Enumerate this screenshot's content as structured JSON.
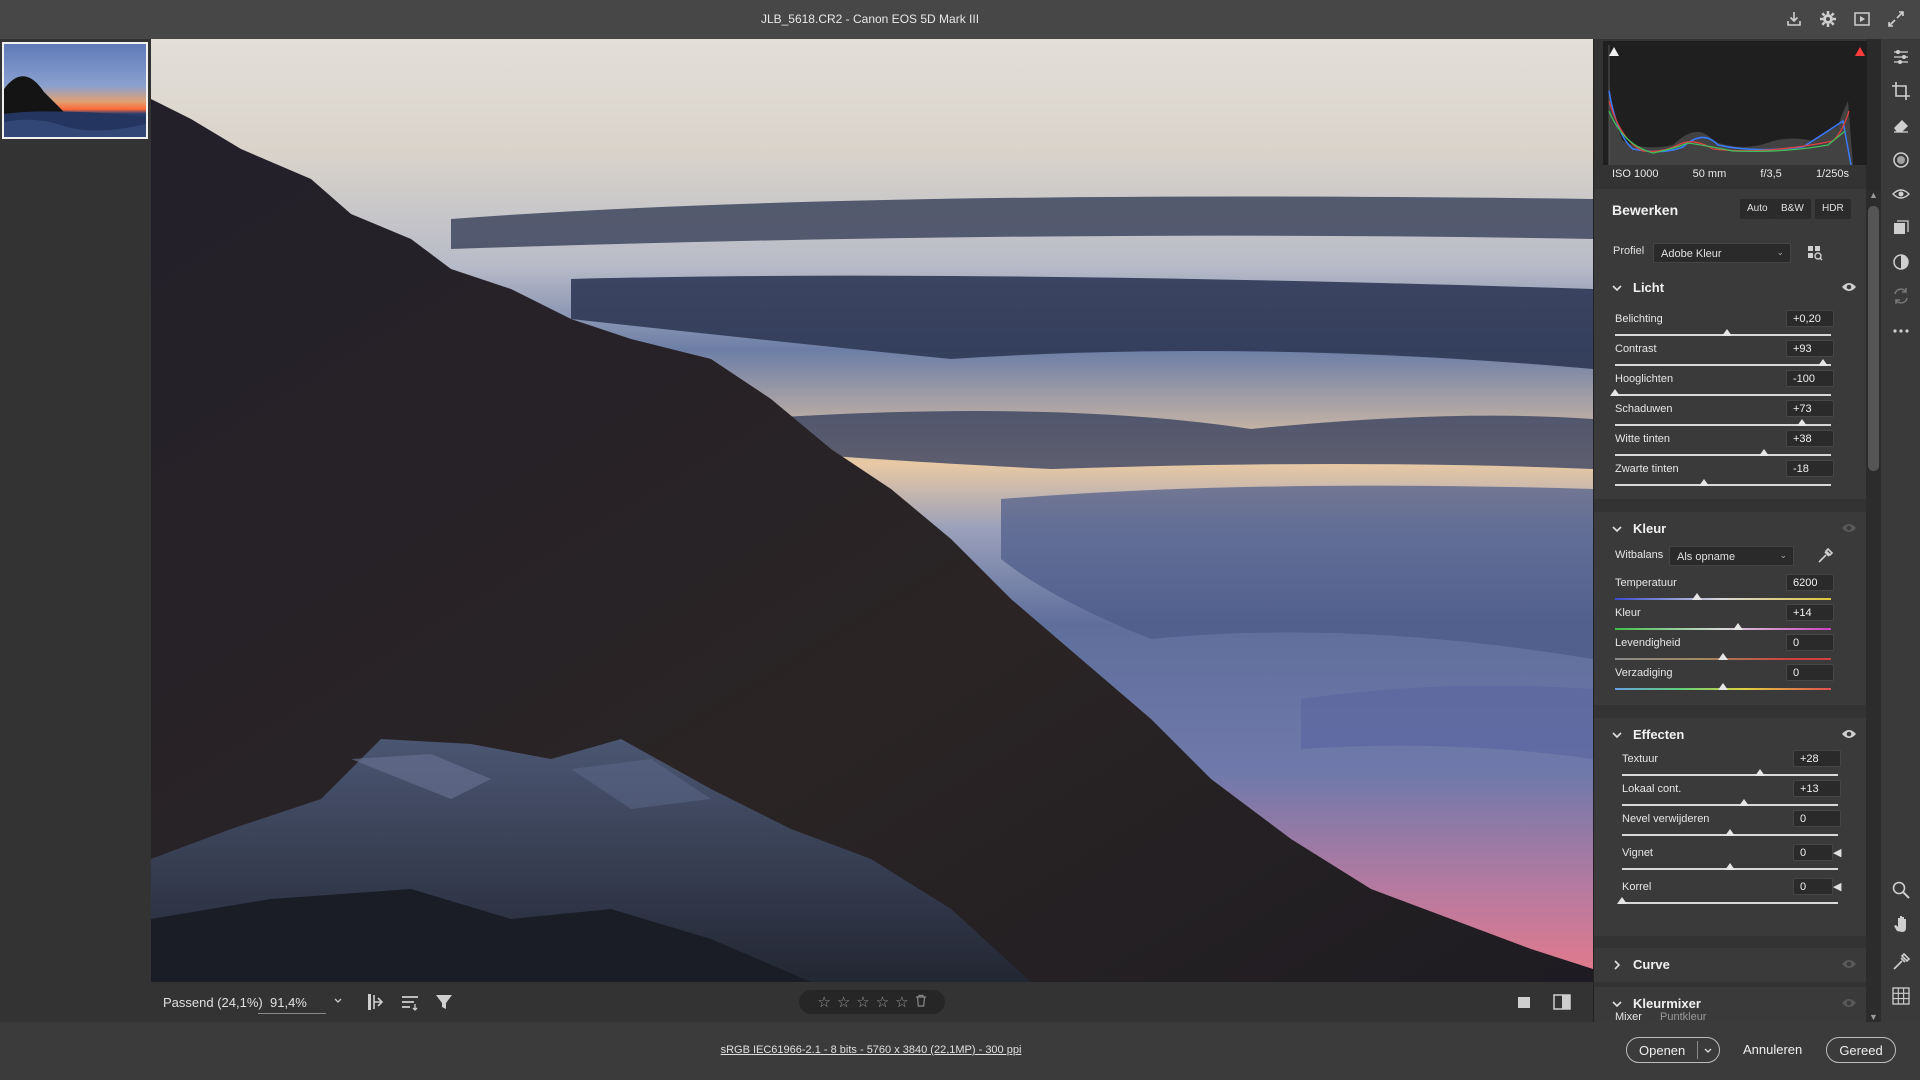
{
  "window": {
    "title": "JLB_5618.CR2  -  Canon EOS 5D Mark III"
  },
  "toolbar_icons": [
    "save-icon",
    "gear-icon",
    "fullscreen-icon",
    "expand-icon"
  ],
  "image_bar": {
    "zoom_fit": "Passend (24,1%)",
    "zoom_value": "91,4%",
    "rating_stars": 0,
    "max_stars": 5
  },
  "status": {
    "file_info": "sRGB IEC61966-2.1 - 8 bits - 5760 x 3840 (22,1MP) - 300 ppi",
    "open_label": "Openen",
    "cancel_label": "Annuleren",
    "done_label": "Gereed"
  },
  "exif": {
    "iso": "ISO 1000",
    "focal": "50 mm",
    "aperture": "f/3,5",
    "shutter": "1/250s"
  },
  "edit": {
    "title": "Bewerken",
    "auto_label": "Auto",
    "bw_label": "B&W",
    "hdr_label": "HDR",
    "profile_label": "Profiel",
    "profile_value": "Adobe Kleur"
  },
  "light": {
    "name": "Licht",
    "sliders": [
      {
        "label": "Belichting",
        "value": "+0,20",
        "pos": 0.52
      },
      {
        "label": "Contrast",
        "value": "+93",
        "pos": 0.965
      },
      {
        "label": "Hooglichten",
        "value": "-100",
        "pos": 0.0
      },
      {
        "label": "Schaduwen",
        "value": "+73",
        "pos": 0.865
      },
      {
        "label": "Witte tinten",
        "value": "+38",
        "pos": 0.69
      },
      {
        "label": "Zwarte tinten",
        "value": "-18",
        "pos": 0.41
      }
    ]
  },
  "color": {
    "name": "Kleur",
    "wb_label": "Witbalans",
    "wb_value": "Als opname",
    "sliders": [
      {
        "label": "Temperatuur",
        "value": "6200",
        "pos": 0.38
      },
      {
        "label": "Kleur",
        "value": "+14",
        "pos": 0.57
      },
      {
        "label": "Levendigheid",
        "value": "0",
        "pos": 0.5
      },
      {
        "label": "Verzadiging",
        "value": "0",
        "pos": 0.5
      }
    ]
  },
  "effects": {
    "name": "Effecten",
    "sliders": [
      {
        "label": "Textuur",
        "value": "+28",
        "pos": 0.64
      },
      {
        "label": "Lokaal cont.",
        "value": "+13",
        "pos": 0.565
      },
      {
        "label": "Nevel verwijderen",
        "value": "0",
        "pos": 0.5
      },
      {
        "label": "Vignet",
        "value": "0",
        "pos": 0.5
      },
      {
        "label": "Korrel",
        "value": "0",
        "pos": 0.0
      }
    ]
  },
  "curve": {
    "name": "Curve"
  },
  "mixer": {
    "name": "Kleurmixer",
    "tab_mixer": "Mixer",
    "tab_point": "Puntkleur"
  },
  "colors": {
    "panel_bg": "#333333",
    "section_bg": "#3a3a3a",
    "accent_red": "#ff3b3b"
  }
}
